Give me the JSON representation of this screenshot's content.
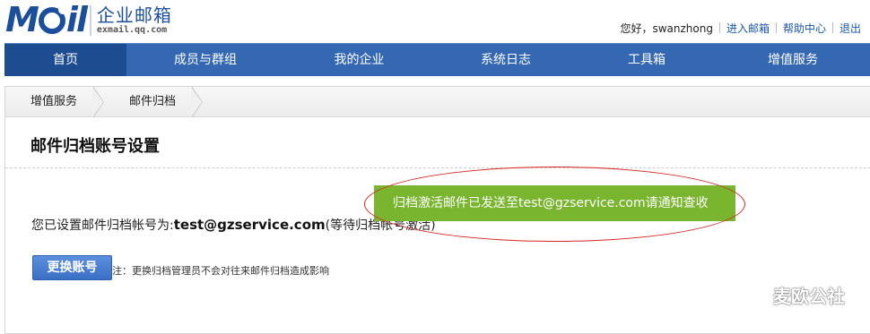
{
  "header": {
    "logo_text": "M",
    "logo_tail": "il",
    "brand_cn": "企业邮箱",
    "brand_en": "exmail.qq.com",
    "greeting": "您好，swanzhong",
    "links": [
      "进入邮箱",
      "帮助中心",
      "退出"
    ]
  },
  "nav": {
    "items": [
      "首页",
      "成员与群组",
      "我的企业",
      "系统日志",
      "工具箱",
      "增值服务"
    ],
    "active_index": 0
  },
  "breadcrumb": [
    "增值服务",
    "邮件归档"
  ],
  "page": {
    "title": "邮件归档账号设置",
    "status_prefix": "您已设置邮件归档帐号为:",
    "archive_account": "test@gzservice.com",
    "status_suffix": "(等待归档帐号激活)",
    "change_button": "更换账号",
    "note": "注：更换归档管理员不会对往来邮件归档造成影响"
  },
  "toast": {
    "message": "归档激活邮件已发送至test@gzservice.com请通知查收"
  },
  "watermark": {
    "text": "麦欧公社",
    "icon": "wechat-icon"
  },
  "colors": {
    "nav_bg": "#3568b2",
    "nav_active": "#1e4c91",
    "brand_blue": "#1c4f9b",
    "link_blue": "#1a56a8",
    "button_blue": "#3a6fc5",
    "toast_green": "#79b52e",
    "highlight_red": "#d42525"
  }
}
